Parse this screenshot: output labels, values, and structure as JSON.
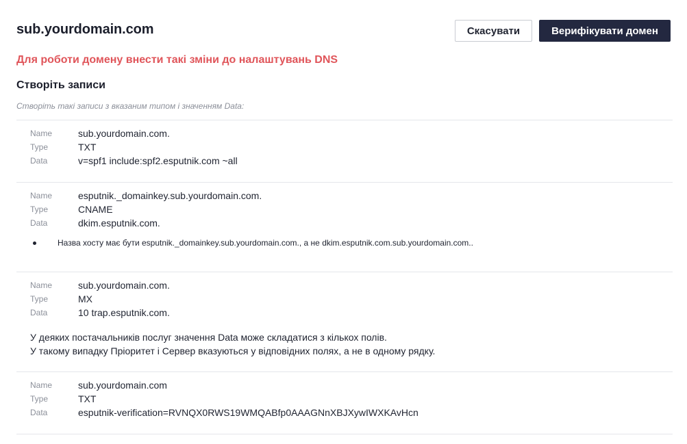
{
  "header": {
    "title": "sub.yourdomain.com",
    "cancel_label": "Скасувати",
    "verify_label": "Верифікувати домен"
  },
  "warning": "Для роботи домену внести такі зміни до налаштувань DNS",
  "section_title": "Створіть записи",
  "section_hint": "Створіть такі записи з вказаним типом і значенням Data:",
  "labels": {
    "name": "Name",
    "type": "Type",
    "data": "Data"
  },
  "records": [
    {
      "name": "sub.yourdomain.com.",
      "type": "TXT",
      "data": "v=spf1 include:spf2.esputnik.com ~all"
    },
    {
      "name": "esputnik._domainkey.sub.yourdomain.com.",
      "type": "CNAME",
      "data": "dkim.esputnik.com.",
      "bullet": "Назва хосту має бути esputnik._domainkey.sub.yourdomain.com., а не dkim.esputnik.com.sub.yourdomain.com.."
    },
    {
      "name": "sub.yourdomain.com.",
      "type": "MX",
      "data": "10 trap.esputnik.com.",
      "note_line1": "У деяких постачальників послуг значення Data може складатися з кількох полів.",
      "note_line2": "У такому випадку Пріоритет і Сервер вказуються у відповідних полях, а не в одному рядку."
    },
    {
      "name": "sub.yourdomain.com",
      "type": "TXT",
      "data": "esputnik-verification=RVNQX0RWS19WMQABfp0AAAGNnXBJXywIWXKAvHcn"
    }
  ]
}
